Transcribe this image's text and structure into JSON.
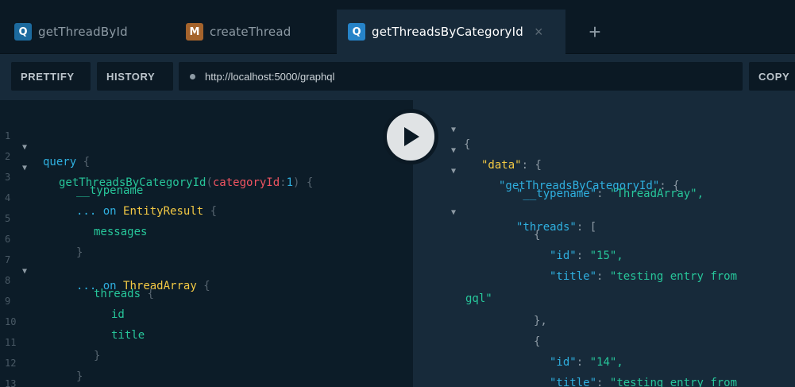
{
  "tabs": [
    {
      "badge": "Q",
      "label": "getThreadById",
      "badge_color": "#1c6a9e"
    },
    {
      "badge": "M",
      "label": "createThread",
      "badge_color": "#a4632c"
    },
    {
      "badge": "Q",
      "label": "getThreadsByCategoryId",
      "badge_color": "#2683c8",
      "close": "×"
    }
  ],
  "add_tab_label": "+",
  "toolbar": {
    "prettify_label": "PRETTIFY",
    "history_label": "HISTORY",
    "url": "http://localhost:5000/graphql",
    "copy_label": "COPY"
  },
  "query": {
    "line_numbers": [
      "1",
      "2",
      "3",
      "4",
      "5",
      "6",
      "7",
      "8",
      "9",
      "10",
      "11",
      "12",
      "13"
    ],
    "kw_query": "query",
    "open_brace": "{",
    "field_root": "getThreadsByCategoryId",
    "paren_open": "(",
    "arg_name": "categoryId",
    "colon": ":",
    "arg_value": "1",
    "paren_close": ")",
    "typename": "__typename",
    "spread": "...",
    "kw_on": "on",
    "type_entity": "EntityResult",
    "field_messages": "messages",
    "close_brace": "}",
    "type_thread": "ThreadArray",
    "field_threads": "threads",
    "field_id": "id",
    "field_title": "title"
  },
  "result": {
    "open_brace": "{",
    "key_data": "\"data\"",
    "key_root": "\"getThreadsByCategoryId\"",
    "key_typename": "\"__typename\"",
    "val_typename": "\"ThreadArray\",",
    "key_threads": "\"threads\"",
    "open_bracket": "[",
    "key_id": "\"id\"",
    "val_id_1": "\"15\",",
    "key_title": "\"title\"",
    "val_title_1a": "\"testing entry from",
    "val_title_1b": "gql\"",
    "close_brace_comma": "},",
    "val_id_2": "\"14\",",
    "val_title_2a": "\"testing entry from",
    "colon": ":"
  }
}
